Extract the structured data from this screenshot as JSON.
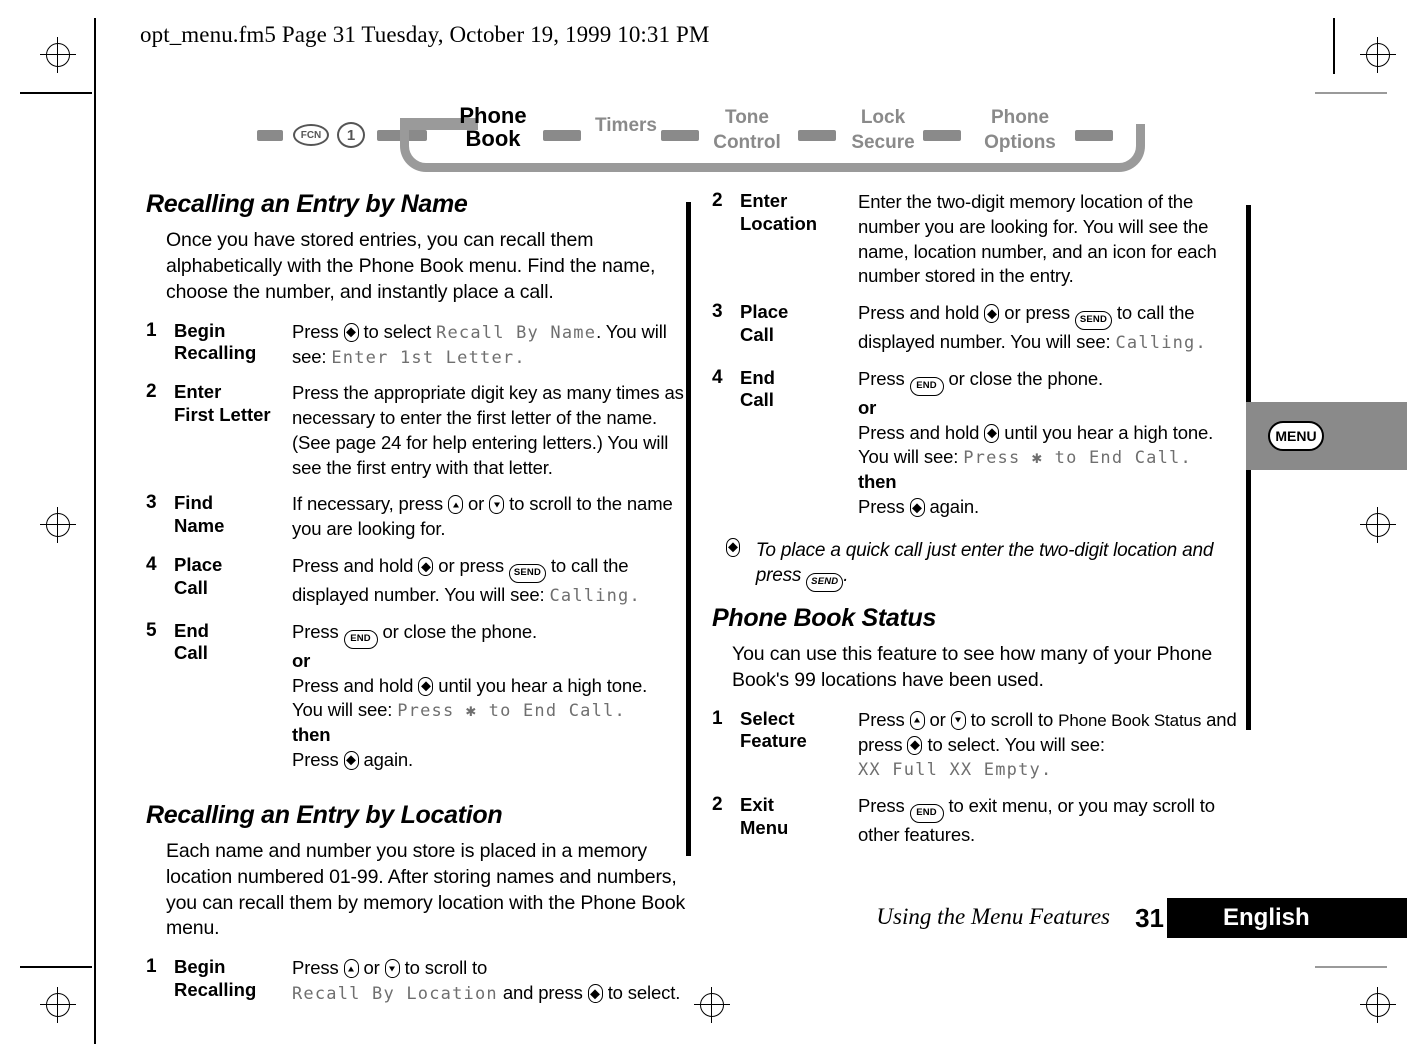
{
  "header": {
    "file_line": "opt_menu.fm5  Page 31  Tuesday, October 19, 1999  10:31 PM"
  },
  "nav_map": {
    "keys": [
      {
        "name": "fcn-key",
        "label": "FCN"
      },
      {
        "name": "digit-key-1",
        "label": "1"
      }
    ],
    "items": [
      {
        "label_lines": [
          "Phone",
          "Book"
        ],
        "active": true
      },
      {
        "label_lines": [
          "Timers"
        ],
        "active": false
      },
      {
        "label_lines": [
          "Tone",
          "Control"
        ],
        "active": false
      },
      {
        "label_lines": [
          "Lock",
          "Secure"
        ],
        "active": false
      },
      {
        "label_lines": [
          "Phone",
          "Options"
        ],
        "active": false
      }
    ]
  },
  "left_column": {
    "section1": {
      "heading": "Recalling an Entry by Name",
      "intro": "Once you have stored entries, you can recall them alphabetically with the Phone Book menu. Find the name, choose the number, and instantly place a call.",
      "steps": [
        {
          "num": "1",
          "term_lines": [
            "Begin",
            "Recalling"
          ],
          "desc_parts": [
            {
              "t": "text",
              "v": "Press "
            },
            {
              "t": "key",
              "v": "nav-select"
            },
            {
              "t": "text",
              "v": " to select "
            },
            {
              "t": "lcd",
              "v": "Recall By Name"
            },
            {
              "t": "text",
              "v": ". You will see: "
            },
            {
              "t": "lcd",
              "v": "Enter 1st Letter."
            }
          ]
        },
        {
          "num": "2",
          "term_lines": [
            "Enter",
            "First Letter"
          ],
          "desc_parts": [
            {
              "t": "text",
              "v": "Press the appropriate digit key as many times as necessary to enter the first letter of the name. (See page 24 for help entering letters.) You will see the first entry with that letter."
            }
          ]
        },
        {
          "num": "3",
          "term_lines": [
            "Find",
            "Name"
          ],
          "desc_parts": [
            {
              "t": "text",
              "v": "If necessary, press "
            },
            {
              "t": "key",
              "v": "nav-up"
            },
            {
              "t": "text",
              "v": " or "
            },
            {
              "t": "key",
              "v": "nav-down"
            },
            {
              "t": "text",
              "v": " to scroll to the name you are looking for."
            }
          ]
        },
        {
          "num": "4",
          "term_lines": [
            "Place",
            "Call"
          ],
          "desc_parts": [
            {
              "t": "text",
              "v": "Press and hold "
            },
            {
              "t": "key",
              "v": "nav-select"
            },
            {
              "t": "text",
              "v": " or press "
            },
            {
              "t": "key",
              "v": "send"
            },
            {
              "t": "text",
              "v": " to call the displayed number. You will see: "
            },
            {
              "t": "lcd",
              "v": "Calling."
            }
          ]
        },
        {
          "num": "5",
          "term_lines": [
            "End",
            "Call"
          ],
          "desc_parts": [
            {
              "t": "text",
              "v": "Press "
            },
            {
              "t": "key",
              "v": "end"
            },
            {
              "t": "text",
              "v": " or close the phone."
            },
            {
              "t": "br"
            },
            {
              "t": "bold",
              "v": "or"
            },
            {
              "t": "br"
            },
            {
              "t": "text",
              "v": "Press and hold "
            },
            {
              "t": "key",
              "v": "nav-select"
            },
            {
              "t": "text",
              "v": " until you hear a high tone."
            },
            {
              "t": "br"
            },
            {
              "t": "text",
              "v": "You will see: "
            },
            {
              "t": "lcd",
              "v": "Press ✱ to End Call."
            },
            {
              "t": "br"
            },
            {
              "t": "bold",
              "v": "then"
            },
            {
              "t": "br"
            },
            {
              "t": "text",
              "v": "Press "
            },
            {
              "t": "key",
              "v": "nav-select"
            },
            {
              "t": "text",
              "v": " again."
            }
          ]
        }
      ]
    },
    "section2": {
      "heading": "Recalling an Entry by Location",
      "intro": "Each name and number you store is placed in a memory location numbered 01-99. After storing names and numbers, you can recall them by memory location with the Phone Book menu.",
      "steps": [
        {
          "num": "1",
          "term_lines": [
            "Begin",
            "Recalling"
          ],
          "desc_parts": [
            {
              "t": "text",
              "v": "Press "
            },
            {
              "t": "key",
              "v": "nav-up"
            },
            {
              "t": "text",
              "v": " or "
            },
            {
              "t": "key",
              "v": "nav-down"
            },
            {
              "t": "text",
              "v": " to scroll to "
            },
            {
              "t": "lcd",
              "v": "Recall By Location"
            },
            {
              "t": "text",
              "v": " and press "
            },
            {
              "t": "key",
              "v": "nav-select"
            },
            {
              "t": "text",
              "v": " to select."
            }
          ]
        }
      ]
    }
  },
  "right_column": {
    "section1_continued": {
      "steps": [
        {
          "num": "2",
          "term_lines": [
            "Enter",
            "Location"
          ],
          "desc_parts": [
            {
              "t": "text",
              "v": "Enter the two-digit memory location of the number you are looking for. You will see the name, location number, and an icon for each number stored in the entry."
            }
          ]
        },
        {
          "num": "3",
          "term_lines": [
            "Place",
            "Call"
          ],
          "desc_parts": [
            {
              "t": "text",
              "v": "Press and hold "
            },
            {
              "t": "key",
              "v": "nav-select"
            },
            {
              "t": "text",
              "v": " or press "
            },
            {
              "t": "key",
              "v": "send"
            },
            {
              "t": "text",
              "v": " to call the displayed number. You will see: "
            },
            {
              "t": "lcd",
              "v": "Calling."
            }
          ]
        },
        {
          "num": "4",
          "term_lines": [
            "End",
            "Call"
          ],
          "desc_parts": [
            {
              "t": "text",
              "v": "Press "
            },
            {
              "t": "key",
              "v": "end"
            },
            {
              "t": "text",
              "v": " or close the phone."
            },
            {
              "t": "br"
            },
            {
              "t": "bold",
              "v": "or"
            },
            {
              "t": "br"
            },
            {
              "t": "text",
              "v": "Press and hold "
            },
            {
              "t": "key",
              "v": "nav-select"
            },
            {
              "t": "text",
              "v": " until you hear a high tone."
            },
            {
              "t": "br"
            },
            {
              "t": "text",
              "v": "You will see: "
            },
            {
              "t": "lcd",
              "v": "Press ✱ to End Call."
            },
            {
              "t": "br"
            },
            {
              "t": "bold",
              "v": "then"
            },
            {
              "t": "br"
            },
            {
              "t": "text",
              "v": "Press "
            },
            {
              "t": "key",
              "v": "nav-select"
            },
            {
              "t": "text",
              "v": " again."
            }
          ]
        }
      ],
      "tip": {
        "icon": "nav-select",
        "parts": [
          {
            "t": "text",
            "v": "To place a quick call just enter the two-digit location and press "
          },
          {
            "t": "key",
            "v": "send"
          },
          {
            "t": "text",
            "v": "."
          }
        ]
      }
    },
    "section2": {
      "heading": "Phone Book Status",
      "intro": "You can use this feature to see how many of your Phone Book's 99 locations have been used.",
      "steps": [
        {
          "num": "1",
          "term_lines": [
            "Select",
            "Feature"
          ],
          "desc_parts": [
            {
              "t": "text",
              "v": "Press "
            },
            {
              "t": "key",
              "v": "nav-up"
            },
            {
              "t": "text",
              "v": " or "
            },
            {
              "t": "key",
              "v": "nav-down"
            },
            {
              "t": "text",
              "v": " to scroll to "
            },
            {
              "t": "textsm",
              "v": "Phone Book Status"
            },
            {
              "t": "text",
              "v": " and press "
            },
            {
              "t": "key",
              "v": "nav-select"
            },
            {
              "t": "text",
              "v": " to select. You will see: "
            },
            {
              "t": "lcd",
              "v": "XX Full XX Empty."
            }
          ]
        },
        {
          "num": "2",
          "term_lines": [
            "Exit",
            "Menu"
          ],
          "desc_parts": [
            {
              "t": "text",
              "v": "Press "
            },
            {
              "t": "key",
              "v": "end"
            },
            {
              "t": "text",
              "v": " to exit menu, or you may scroll to other features."
            }
          ]
        }
      ]
    }
  },
  "side_tab": {
    "label": "MENU"
  },
  "footer": {
    "title": "Using the Menu Features",
    "page_number": "31",
    "language": "English"
  },
  "colors": {
    "nav_inactive": "#8a8a8a",
    "lcd_text": "#6f6f6f",
    "tab_background": "#8a8a8a",
    "footer_bar": "#000000"
  }
}
